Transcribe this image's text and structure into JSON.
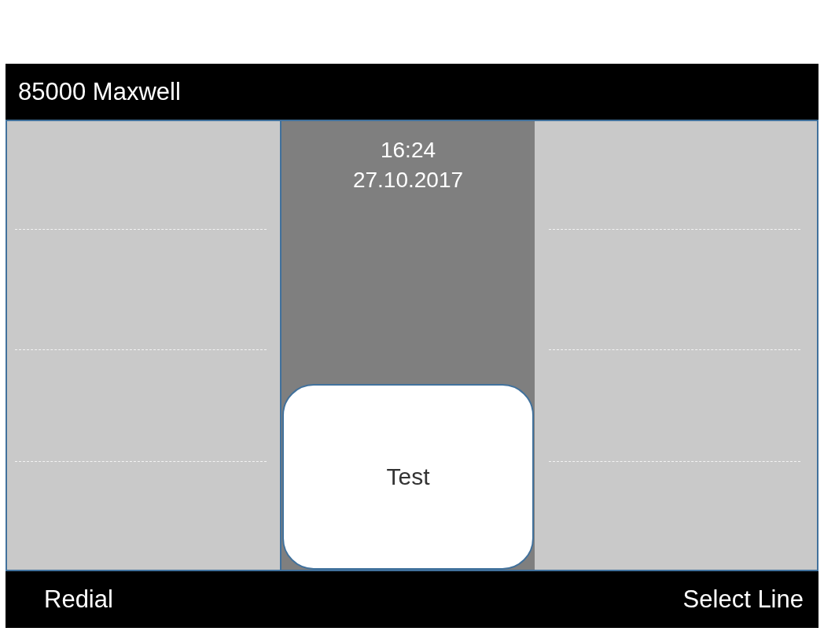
{
  "header": {
    "title": "85000 Maxwell"
  },
  "clock": {
    "time": "16:24",
    "date": "27.10.2017"
  },
  "center_button": {
    "label": "Test"
  },
  "softkeys": [
    {
      "label": "Redial"
    },
    {
      "label": "Select Line"
    }
  ]
}
